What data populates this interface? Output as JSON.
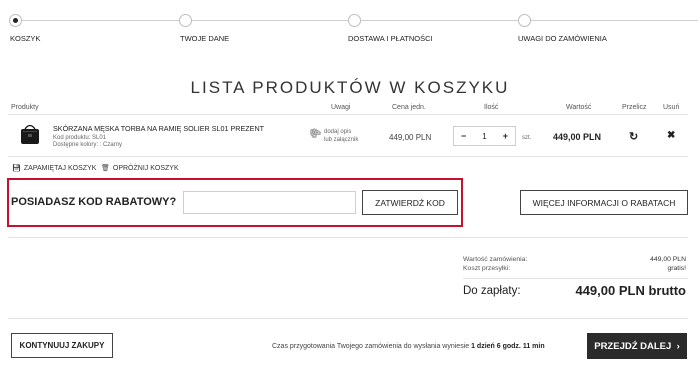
{
  "steps": [
    {
      "label": "KOSZYK",
      "active": true
    },
    {
      "label": "TWOJE DANE",
      "active": false
    },
    {
      "label": "DOSTAWA I PŁATNOŚCI",
      "active": false
    },
    {
      "label": "UWAGI DO ZAMÓWIENIA",
      "active": false
    }
  ],
  "title": "LISTA PRODUKTÓW W KOSZYKU",
  "table_headers": {
    "products": "Produkty",
    "notes": "Uwagi",
    "unit_price": "Cena jedn.",
    "quantity": "Ilość",
    "value": "Wartość",
    "recalc": "Przelicz",
    "remove": "Usuń"
  },
  "product": {
    "name": "SKÓRZANA MĘSKA TORBA NA RAMIĘ SOLIER SL01 PREZENT",
    "code_label": "Kod produktu:",
    "code": "SL01",
    "colors_label": "Dostępne kolory:",
    "colors": ": Czarny",
    "note_line1": "dodaj opis",
    "note_line2": "lub załącznik",
    "unit_price": "449,00 PLN",
    "quantity": "1",
    "unit": "szt.",
    "value": "449,00 PLN",
    "qty_minus": "−",
    "qty_plus": "+"
  },
  "cart_actions": {
    "save": "ZAPAMIĘTAJ KOSZYK",
    "clear": "OPRÓŻNIJ KOSZYK"
  },
  "discount": {
    "label": "POSIADASZ KOD RABATOWY?",
    "input_value": "",
    "submit": "ZATWIERDŹ KOD",
    "more_info": "WIĘCEJ INFORMACJI O RABATACH"
  },
  "summary": {
    "order_value_label": "Wartość zamówienia:",
    "order_value": "449,00 PLN",
    "shipping_label": "Koszt przesyłki:",
    "shipping": "gratis!",
    "to_pay_label": "Do zapłaty:",
    "to_pay": "449,00 PLN brutto"
  },
  "footer": {
    "continue": "KONTYNUUJ ZAKUPY",
    "prep_text": "Czas przygotowania Twojego zamówienia do wysłania wyniesie",
    "prep_time": "1 dzień 6 godz. 11 min",
    "next": "PRZEJDŹ DALEJ",
    "next_arrow": "›"
  },
  "colors": {
    "accent_red": "#c8102e",
    "dark_button": "#2b2b2b"
  }
}
